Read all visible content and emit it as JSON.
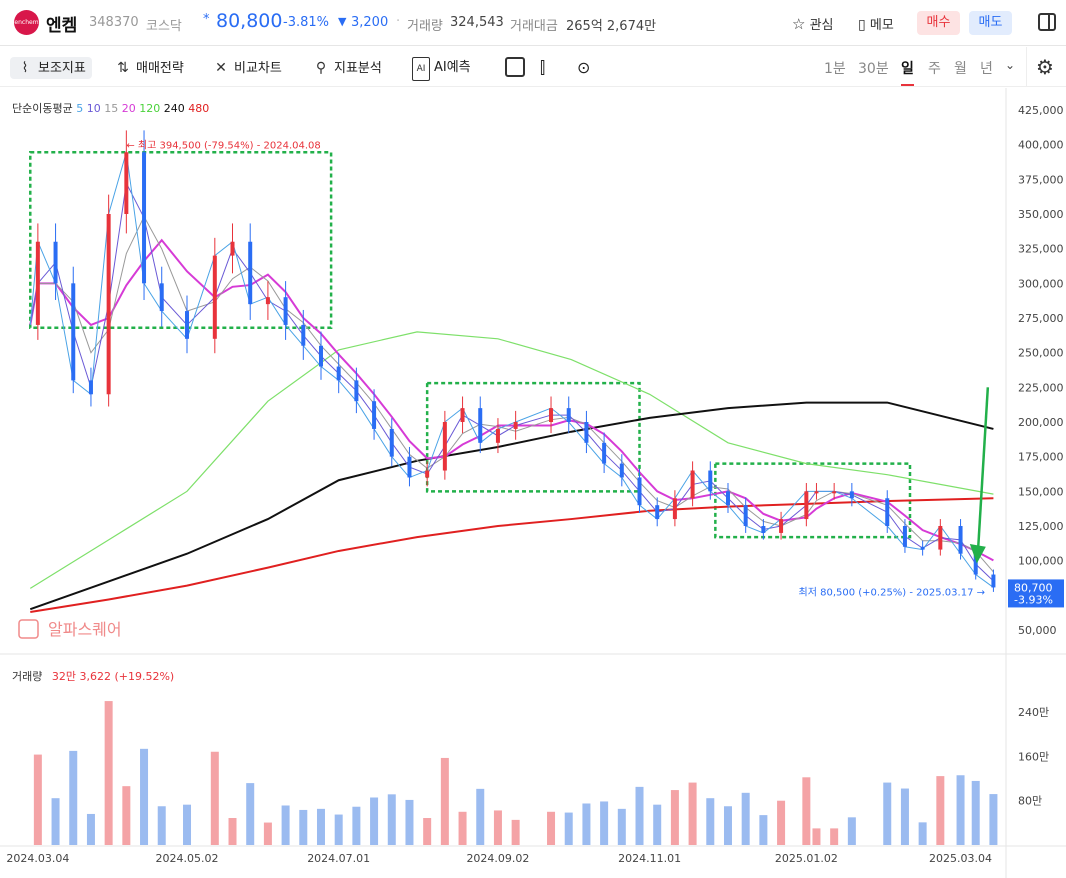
{
  "header": {
    "logo_text": "enchem",
    "name": "엔켐",
    "code": "348370",
    "market": "코스닥",
    "price": "80,800",
    "change_pct": "-3.81%",
    "change_abs": "3,200",
    "volume_label": "거래량",
    "volume": "324,543",
    "amount_label": "거래대금",
    "amount": "265억 2,674만",
    "watch_label": "관심",
    "memo_label": "메모",
    "buy_label": "매수",
    "sell_label": "매도",
    "colors": {
      "up": "#e8333b",
      "down": "#2a6df4"
    }
  },
  "toolbar": {
    "indicators": "보조지표",
    "strategy": "매매전략",
    "compare": "비교차트",
    "analysis": "지표분석",
    "ai": "AI예측",
    "timeframes": [
      "1분",
      "30분",
      "일",
      "주",
      "월",
      "년"
    ],
    "active_timeframe": "일",
    "icons": [
      "indicator-icon",
      "strategy-icon",
      "compare-icon",
      "analysis-icon",
      "ai-icon",
      "square-icon",
      "candle-icon",
      "camera-icon",
      "settings-icon"
    ]
  },
  "chart_data": {
    "type": "line",
    "title": "",
    "ma_legend_label": "단순이동평균",
    "ma_periods": [
      {
        "period": "5",
        "color": "#4aa3e6"
      },
      {
        "period": "10",
        "color": "#6a5ad6"
      },
      {
        "period": "15",
        "color": "#999999"
      },
      {
        "period": "20",
        "color": "#d63bd6"
      },
      {
        "period": "120",
        "color": "#4cd23c"
      },
      {
        "period": "240",
        "color": "#111111"
      },
      {
        "period": "480",
        "color": "#e02020"
      }
    ],
    "y_ticks": [
      "425,000",
      "400,000",
      "375,000",
      "350,000",
      "325,000",
      "300,000",
      "275,000",
      "250,000",
      "225,000",
      "200,000",
      "175,000",
      "150,000",
      "125,000",
      "100,000",
      "50,000"
    ],
    "x_ticks": [
      "2024.03.04",
      "2024.05.02",
      "2024.07.01",
      "2024.09.02",
      "2024.11.01",
      "2025.01.02",
      "2025.03.04"
    ],
    "max_annotation": "최고 394,500 (-79.54%) - 2024.04.08",
    "min_annotation": "최저 80,500 (+0.25%) - 2025.03.17",
    "last_price": "80,700",
    "last_pct": "-3.93%",
    "watermark": "알파스퀘어",
    "ylim": [
      60000,
      425000
    ],
    "close_series": {
      "x": [
        "2024.03.01",
        "2024.03.04",
        "2024.03.11",
        "2024.03.18",
        "2024.03.25",
        "2024.04.01",
        "2024.04.08",
        "2024.04.15",
        "2024.04.22",
        "2024.05.02",
        "2024.05.13",
        "2024.05.20",
        "2024.05.27",
        "2024.06.03",
        "2024.06.10",
        "2024.06.17",
        "2024.06.24",
        "2024.07.01",
        "2024.07.08",
        "2024.07.15",
        "2024.07.22",
        "2024.07.29",
        "2024.08.05",
        "2024.08.12",
        "2024.08.19",
        "2024.08.26",
        "2024.09.02",
        "2024.09.09",
        "2024.09.23",
        "2024.09.30",
        "2024.10.07",
        "2024.10.14",
        "2024.10.21",
        "2024.10.28",
        "2024.11.04",
        "2024.11.11",
        "2024.11.18",
        "2024.11.25",
        "2024.12.02",
        "2024.12.09",
        "2024.12.16",
        "2024.12.23",
        "2025.01.02",
        "2025.01.06",
        "2025.01.13",
        "2025.01.20",
        "2025.02.03",
        "2025.02.10",
        "2025.02.17",
        "2025.02.24",
        "2025.03.04",
        "2025.03.10",
        "2025.03.17"
      ],
      "y": [
        270000,
        330000,
        300000,
        230000,
        220000,
        350000,
        394500,
        300000,
        280000,
        260000,
        320000,
        330000,
        285000,
        290000,
        270000,
        255000,
        240000,
        230000,
        215000,
        195000,
        175000,
        160000,
        165000,
        200000,
        210000,
        185000,
        195000,
        200000,
        210000,
        200000,
        185000,
        170000,
        160000,
        140000,
        130000,
        145000,
        165000,
        150000,
        140000,
        125000,
        120000,
        130000,
        150000,
        150000,
        150000,
        145000,
        125000,
        110000,
        108000,
        125000,
        105000,
        90000,
        80700
      ]
    },
    "ma120": {
      "x": [
        "2024.03.01",
        "2024.04.01",
        "2024.05.02",
        "2024.06.03",
        "2024.07.01",
        "2024.08.01",
        "2024.09.02",
        "2024.10.01",
        "2024.11.01",
        "2024.12.02",
        "2025.01.02",
        "2025.02.03",
        "2025.03.17"
      ],
      "y": [
        80000,
        115000,
        150000,
        215000,
        252000,
        265000,
        260000,
        245000,
        220000,
        185000,
        170000,
        162000,
        148000
      ]
    },
    "ma240": {
      "x": [
        "2024.03.01",
        "2024.04.01",
        "2024.05.02",
        "2024.06.03",
        "2024.07.01",
        "2024.08.01",
        "2024.09.02",
        "2024.10.01",
        "2024.11.01",
        "2024.12.02",
        "2025.01.02",
        "2025.02.03",
        "2025.03.17"
      ],
      "y": [
        65000,
        85000,
        105000,
        130000,
        158000,
        172000,
        182000,
        193000,
        203000,
        210000,
        214000,
        214000,
        195000
      ]
    },
    "ma480": {
      "x": [
        "2024.03.01",
        "2024.04.01",
        "2024.05.02",
        "2024.06.03",
        "2024.07.01",
        "2024.08.01",
        "2024.09.02",
        "2024.10.01",
        "2024.11.01",
        "2024.12.02",
        "2025.01.02",
        "2025.02.03",
        "2025.03.17"
      ],
      "y": [
        63000,
        72000,
        82000,
        95000,
        107000,
        117000,
        125000,
        130000,
        136000,
        139000,
        141000,
        143000,
        145000
      ]
    },
    "volume": {
      "label": "거래량",
      "value": "32만 3,622 (+19.52%)",
      "y_ticks": [
        "240만",
        "160만",
        "80만"
      ],
      "ylim": [
        0,
        2800000
      ]
    }
  }
}
